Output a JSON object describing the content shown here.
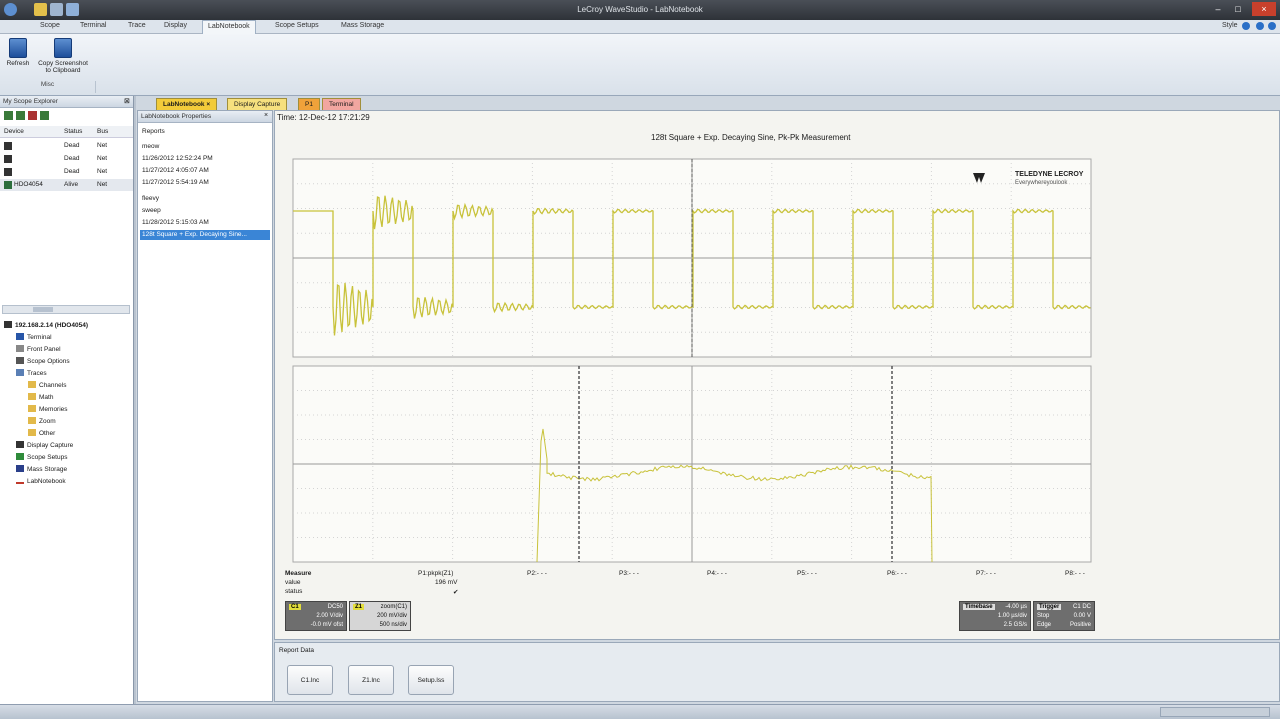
{
  "app": {
    "title": "LeCroy WaveStudio - LabNotebook",
    "style_label": "Style"
  },
  "menu": [
    "Scope",
    "Terminal",
    "Trace",
    "Display",
    "LabNotebook",
    "Scope Setups",
    "Mass Storage"
  ],
  "ribbon": {
    "refresh": "Refresh",
    "copy": "Copy Screenshot to Clipboard",
    "group": "Misc"
  },
  "explorer": {
    "title": "My Scope Explorer",
    "columns": [
      "Device",
      "Status",
      "Bus"
    ],
    "devices": [
      {
        "name": "",
        "status": "Dead",
        "bus": "Net"
      },
      {
        "name": "",
        "status": "Dead",
        "bus": "Net"
      },
      {
        "name": "",
        "status": "Dead",
        "bus": "Net"
      },
      {
        "name": "HDO4054",
        "status": "Alive",
        "bus": "Net"
      }
    ],
    "root": "192.168.2.14 (HDO4054)",
    "tree": [
      "Terminal",
      "Front Panel",
      "Scope Options",
      "Traces",
      "Channels",
      "Math",
      "Memories",
      "Zoom",
      "Other",
      "Display Capture",
      "Scope Setups",
      "Mass Storage",
      "LabNotebook"
    ]
  },
  "doctabs": [
    "LabNotebook",
    "Display Capture",
    "P1",
    "Terminal"
  ],
  "props": {
    "title": "LabNotebook Properties",
    "reports_label": "Reports",
    "items": [
      "meow",
      "11/26/2012 12:52:24 PM",
      "11/27/2012 4:05:07 AM",
      "11/27/2012 5:54:19 AM",
      "fleevy",
      "sweep",
      "11/28/2012 5:15:03 AM",
      "128t Square + Exp. Decaying Sine..."
    ]
  },
  "scope": {
    "time": "Time: 12-Dec-12 17:21:29",
    "title": "128t Square + Exp. Decaying Sine, Pk-Pk Measurement",
    "logo_line1": "TELEDYNE LECROY",
    "logo_line2": "Everywhereyoulook",
    "measure_header": [
      "Measure",
      "value",
      "status"
    ],
    "params": [
      "P1:pkpk(Z1)",
      "P2:- - -",
      "P3:- - -",
      "P4:- - -",
      "P5:- - -",
      "P6:- - -",
      "P7:- - -",
      "P8:- - -"
    ],
    "p1_value": "196 mV",
    "p1_status": "✔",
    "c1": {
      "label": "C1",
      "l1": "DC50",
      "l2": "2.00 V/div",
      "l3": "-0.0 mV ofst"
    },
    "z1": {
      "label": "Z1",
      "l1": "zoom(C1)",
      "l2": "200 mV/div",
      "l3": "500 ns/div"
    },
    "timebase": {
      "title": "Timebase",
      "v1": "-4.00 µs",
      "l2": "1.00 µs/div",
      "l3": "2.5 GS/s"
    },
    "trigger": {
      "title": "Trigger",
      "v1": "C1 DC",
      "l2": "Stop",
      "v2": "0.00 V",
      "l3": "Edge",
      "v3": "Positive"
    }
  },
  "report_data": {
    "title": "Report Data",
    "files": [
      "C1.lnc",
      "Z1.lnc",
      "Setup.lss"
    ]
  },
  "colors": {
    "trace": "#c8c23a",
    "grid": "#c8c8c8",
    "tab_active": "#f2cb3a"
  }
}
